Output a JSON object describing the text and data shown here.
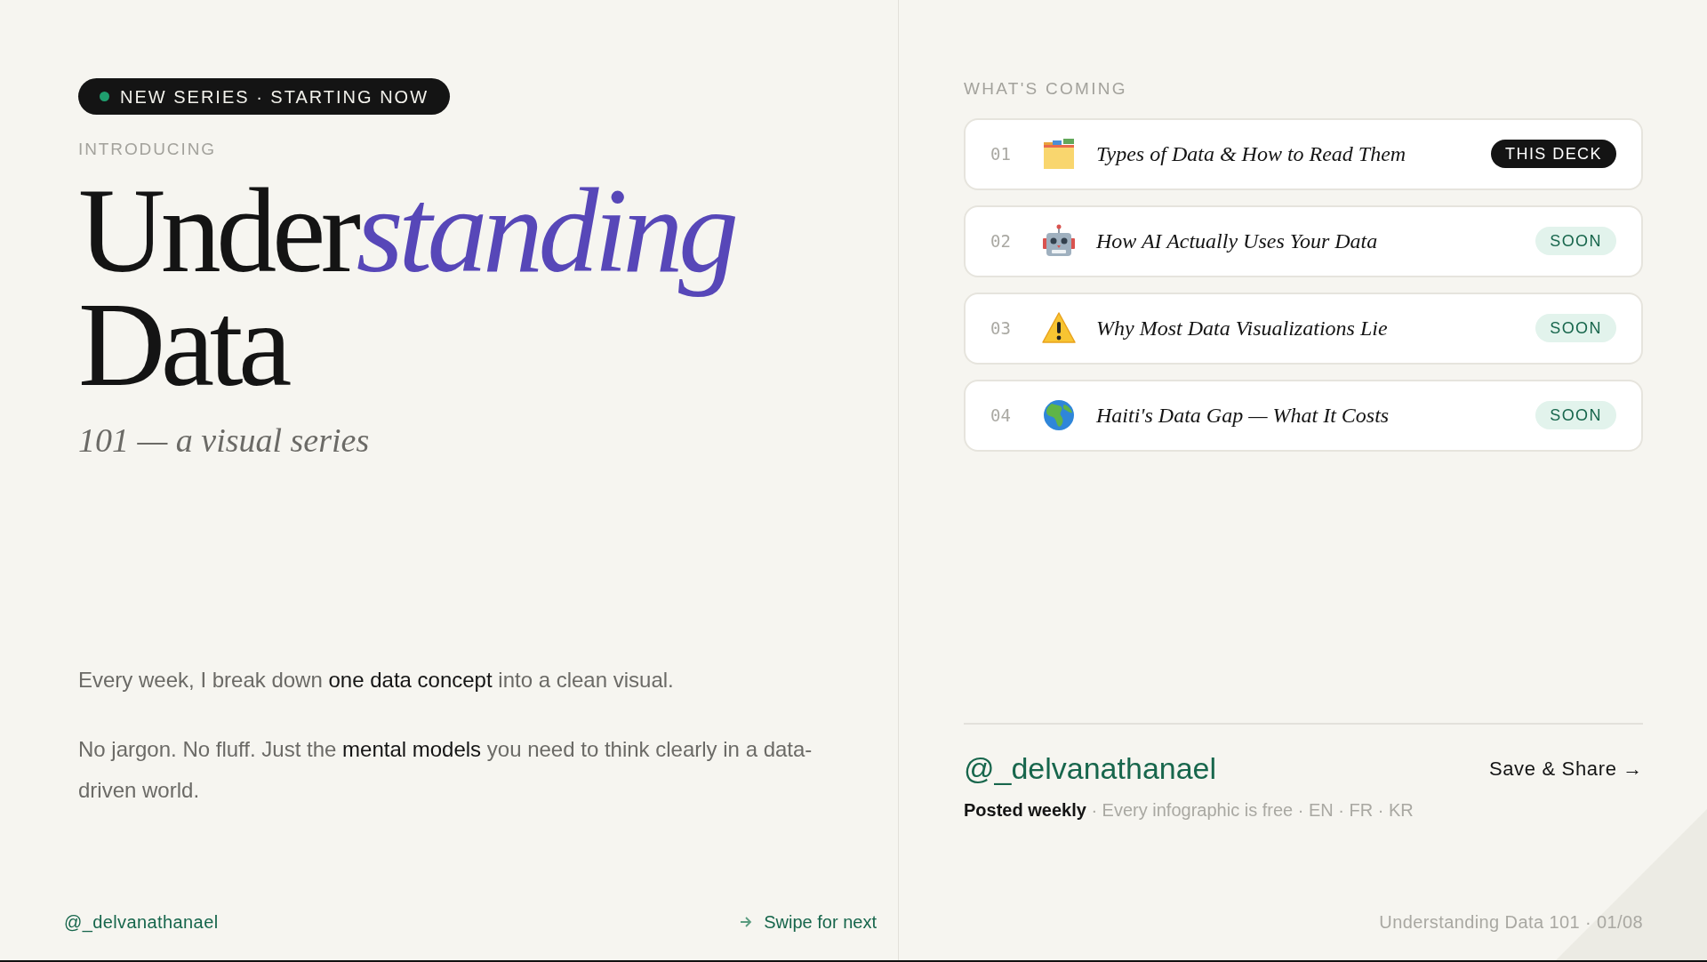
{
  "left": {
    "badge": "NEW SERIES · STARTING NOW",
    "eyebrow": "INTRODUCING",
    "title_lines": [
      [
        {
          "text": "Under",
          "kind": "plain"
        },
        {
          "text": "standing",
          "kind": "accent"
        }
      ],
      [
        {
          "text": "Data",
          "kind": "plain"
        }
      ]
    ],
    "subtitle": "101 — a visual series",
    "paragraphs": [
      "Every week, I break down **one data concept** into a clean visual.",
      "No jargon. No fluff. Just the **mental models** you need to think clearly in a data-driven world."
    ],
    "footer": {
      "handle": "@_delvanathanael",
      "next": "Swipe for next"
    }
  },
  "right": {
    "heading": "WHAT'S COMING",
    "items": [
      {
        "number": "01",
        "title": "Types of Data & How to Read Them",
        "selected": true,
        "tag": "THIS DECK"
      },
      {
        "number": "02",
        "title": "How AI Actually Uses Your Data",
        "selected": false,
        "tag": "SOON"
      },
      {
        "number": "03",
        "title": "Why Most Data Visualizations Lie",
        "selected": false,
        "tag": "SOON"
      },
      {
        "number": "04",
        "title": "Haiti's Data Gap — What It Costs",
        "selected": false,
        "tag": "SOON"
      }
    ],
    "author": {
      "handle": "@_delvanathanael",
      "action": "Save & Share →",
      "schedule": "Posted weekly",
      "details": " · Every infographic is free · EN · FR · KR"
    },
    "footer": "Understanding Data 101 · 01/08"
  }
}
